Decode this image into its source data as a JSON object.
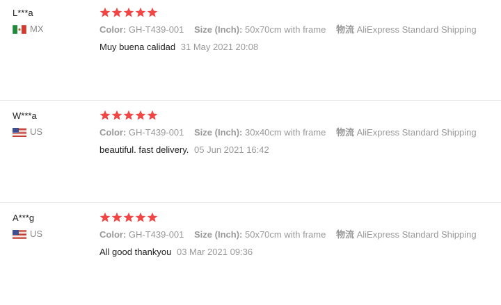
{
  "colors": {
    "star": "#f04646",
    "label": "#999999",
    "text": "#222222"
  },
  "reviews": [
    {
      "name": "L***a",
      "country": "MX",
      "flag_icon": "mexico-flag-icon",
      "rating": 5,
      "color_label": "Color:",
      "color_value": "GH-T439-001",
      "size_label": "Size (Inch):",
      "size_value": "50x70cm with frame",
      "shipping_label": "物流",
      "shipping_value": "AliExpress Standard Shipping",
      "text": "Muy buena calidad",
      "date": "31 May 2021 20:08"
    },
    {
      "name": "W***a",
      "country": "US",
      "flag_icon": "us-flag-icon",
      "rating": 5,
      "color_label": "Color:",
      "color_value": "GH-T439-001",
      "size_label": "Size (Inch):",
      "size_value": "30x40cm with frame",
      "shipping_label": "物流",
      "shipping_value": "AliExpress Standard Shipping",
      "text": "beautiful. fast delivery.",
      "date": "05 Jun 2021 16:42"
    },
    {
      "name": "A***g",
      "country": "US",
      "flag_icon": "us-flag-icon",
      "rating": 5,
      "color_label": "Color:",
      "color_value": "GH-T439-001",
      "size_label": "Size (Inch):",
      "size_value": "50x70cm with frame",
      "shipping_label": "物流",
      "shipping_value": "AliExpress Standard Shipping",
      "text": "All good thankyou",
      "date": "03 Mar 2021 09:36"
    }
  ]
}
